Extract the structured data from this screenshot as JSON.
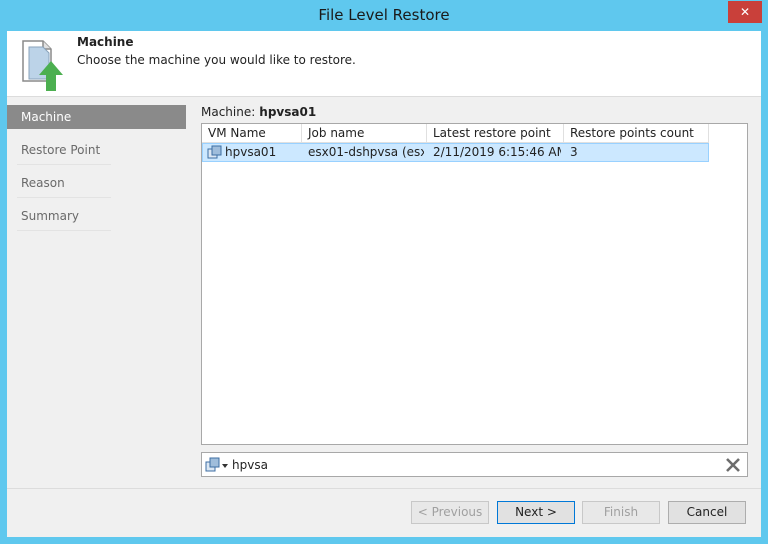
{
  "window": {
    "title": "File Level Restore",
    "close_glyph": "✕"
  },
  "header": {
    "title": "Machine",
    "subtitle": "Choose the machine you would like to restore.",
    "icon": "restore-document-icon"
  },
  "steps": [
    {
      "label": "Machine",
      "active": true
    },
    {
      "label": "Restore Point",
      "active": false
    },
    {
      "label": "Reason",
      "active": false
    },
    {
      "label": "Summary",
      "active": false
    }
  ],
  "machine": {
    "label": "Machine:",
    "value": "hpvsa01"
  },
  "table": {
    "columns": [
      "VM Name",
      "Job name",
      "Latest restore point",
      "Restore points count"
    ],
    "rows": [
      {
        "vm_name": "hpvsa01",
        "job_name": "esx01-dshpvsa (esx...",
        "latest_restore_point": "2/11/2019 6:15:46 AM",
        "restore_points_count": "3",
        "selected": true
      }
    ]
  },
  "search": {
    "value": "hpvsa",
    "placeholder": ""
  },
  "buttons": {
    "previous": "< Previous",
    "next": "Next >",
    "finish": "Finish",
    "cancel": "Cancel"
  },
  "colors": {
    "titlebar": "#5fc8ee",
    "selection": "#cce8ff",
    "active_step": "#8a8a8a",
    "accent_green": "#4caf50"
  }
}
